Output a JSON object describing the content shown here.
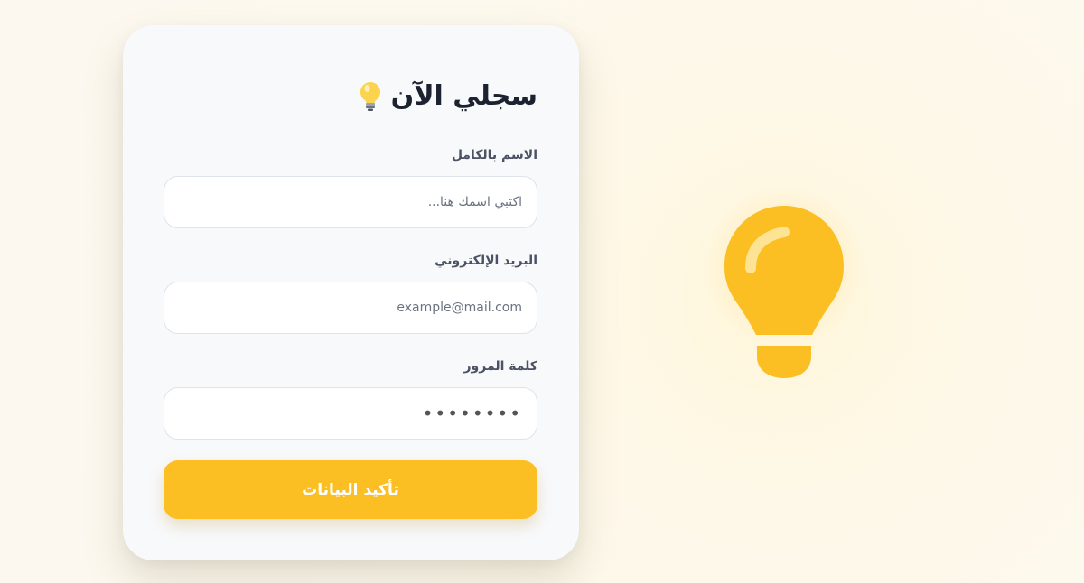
{
  "form": {
    "title": "سجلي الآن",
    "title_icon": "lightbulb-icon",
    "fields": [
      {
        "label": "الاسم بالكامل",
        "placeholder": "اكتبي اسمك هنا...",
        "value": ""
      },
      {
        "label": "البريد الإلكتروني",
        "placeholder": "example@mail.com",
        "value": ""
      },
      {
        "label": "كلمة المرور",
        "placeholder": "",
        "value": "••••••••"
      }
    ],
    "submit_label": "تأكيد البيانات"
  },
  "illustration": {
    "icon": "lightbulb-icon"
  },
  "colors": {
    "accent": "#fbbf24",
    "background": "#fdf9ef",
    "card": "#f8f9fb",
    "title": "#1c2230",
    "label": "#4a5263"
  }
}
